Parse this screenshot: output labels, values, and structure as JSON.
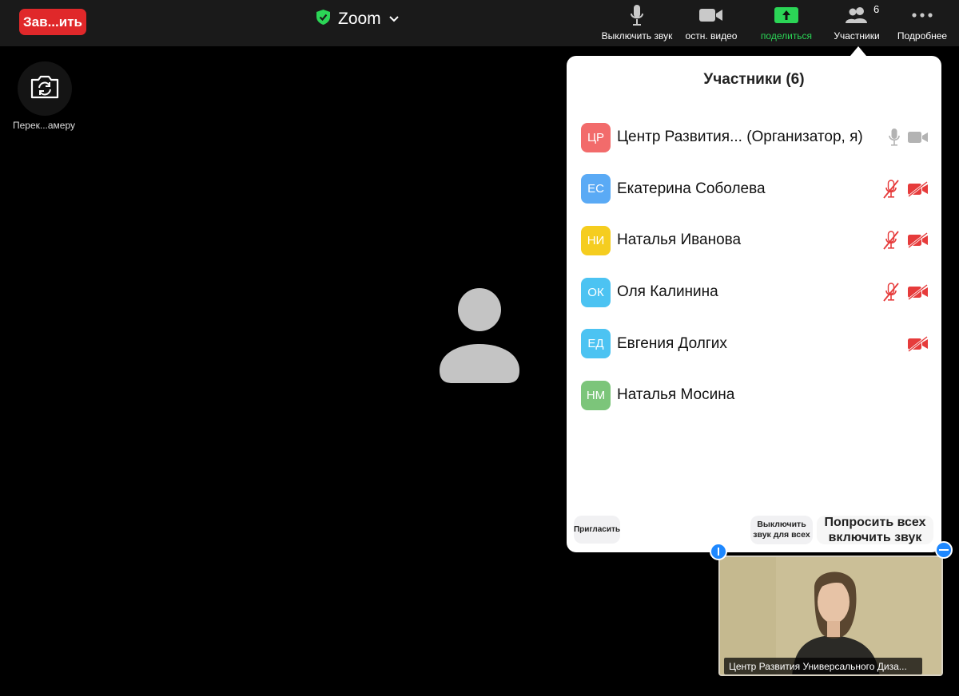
{
  "topbar": {
    "end_label": "Зав...ить",
    "title": "Zoom",
    "mute_label": "Выключить звук",
    "video_label": "остн. видео",
    "share_label": "поделиться",
    "participants_label": "Участники",
    "participants_count": "6",
    "more_label": "Подробнее",
    "share_color": "#2bd556"
  },
  "switch_camera": {
    "label": "Перек...амеру"
  },
  "panel": {
    "title": "Участники (6)",
    "participants": [
      {
        "initials": "ЦР",
        "name": "Центр Развития... (Организатор, я)",
        "color": "#f26b6b",
        "mic": "on",
        "video": "on"
      },
      {
        "initials": "ЕС",
        "name": "Екатерина Соболева",
        "color": "#5aaaf5",
        "mic": "muted",
        "video": "off"
      },
      {
        "initials": "НИ",
        "name": "Наталья Иванова",
        "color": "#f5cd1f",
        "mic": "muted",
        "video": "off"
      },
      {
        "initials": "ОК",
        "name": "Оля Калинина",
        "color": "#4cc3f2",
        "mic": "muted",
        "video": "off"
      },
      {
        "initials": "ЕД",
        "name": "Евгения Долгих",
        "color": "#4cc3f2",
        "mic": "none",
        "video": "off"
      },
      {
        "initials": "НМ",
        "name": "Наталья Мосина",
        "color": "#7cc57a",
        "mic": "none",
        "video": "none"
      }
    ],
    "invite_label": "Пригласить",
    "mute_all_label": "Выключить звук для всех",
    "ask_unmute_label": "Попросить всех включить звук"
  },
  "self_view": {
    "label": "Центр Развития Универсального Диза..."
  }
}
